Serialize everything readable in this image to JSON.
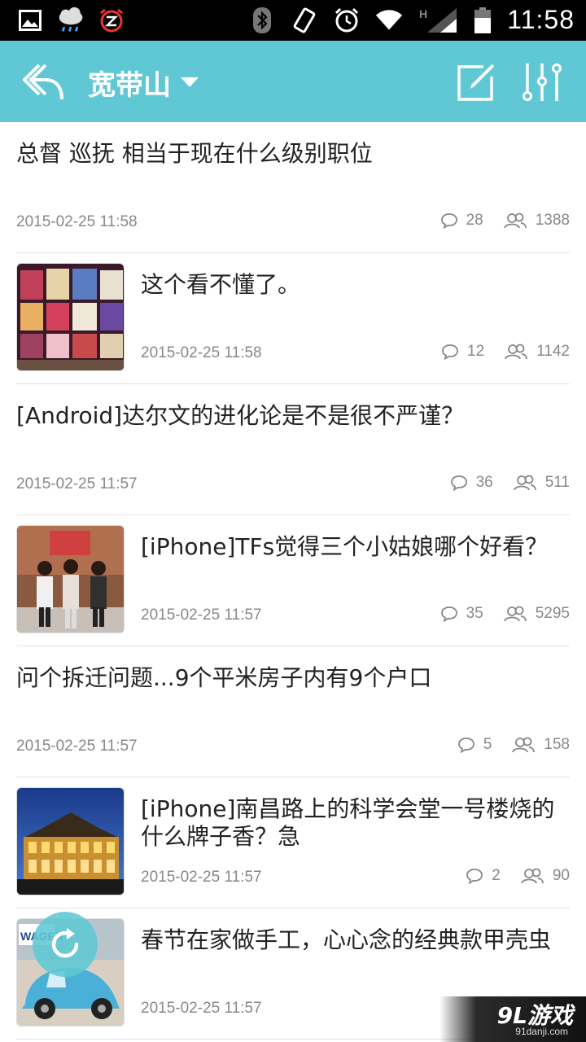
{
  "status_bar": {
    "time": "11:58",
    "left_icons": [
      "image-icon",
      "weather-rain-icon",
      "alarm-z-icon"
    ],
    "right_icons": [
      "bluetooth-icon",
      "vibrate-icon",
      "alarm-clock-icon",
      "wifi-icon",
      "signal-h-icon",
      "battery-icon"
    ]
  },
  "header": {
    "title": "宽带山",
    "background": "#5fc8d4",
    "icons": [
      "back-arrow-icon",
      "compose-icon",
      "filter-sliders-icon"
    ]
  },
  "feed": {
    "items": [
      {
        "title": "总督 巡抚 相当于现在什么级别职位",
        "time": "2015-02-25 11:58",
        "comments": "28",
        "views": "1388",
        "has_thumb": false
      },
      {
        "title": "这个看不懂了。",
        "time": "2015-02-25 11:58",
        "comments": "12",
        "views": "1142",
        "has_thumb": true,
        "thumb": "menu-board-photo"
      },
      {
        "title": "[Android]达尔文的进化论是不是很不严谨？",
        "time": "2015-02-25 11:57",
        "comments": "36",
        "views": "511",
        "has_thumb": false
      },
      {
        "title": "[iPhone]TFs觉得三个小姑娘哪个好看？",
        "time": "2015-02-25 11:57",
        "comments": "35",
        "views": "5295",
        "has_thumb": true,
        "thumb": "three-girls-photo"
      },
      {
        "title": "问个拆迁问题...9个平米房子内有9个户口",
        "time": "2015-02-25 11:57",
        "comments": "5",
        "views": "158",
        "has_thumb": false
      },
      {
        "title": "[iPhone]南昌路上的科学会堂一号楼烧的什么牌子香？急",
        "time": "2015-02-25 11:57",
        "comments": "2",
        "views": "90",
        "has_thumb": true,
        "thumb": "lit-building-photo"
      },
      {
        "title": "春节在家做手工，心心念的经典款甲壳虫",
        "time": "2015-02-25 11:57",
        "comments": "",
        "views": "",
        "has_thumb": true,
        "thumb": "beetle-car-photo"
      }
    ]
  },
  "fab": {
    "icon": "refresh-icon"
  },
  "watermark": {
    "brand": "9L游戏",
    "url": "91danji.com"
  }
}
